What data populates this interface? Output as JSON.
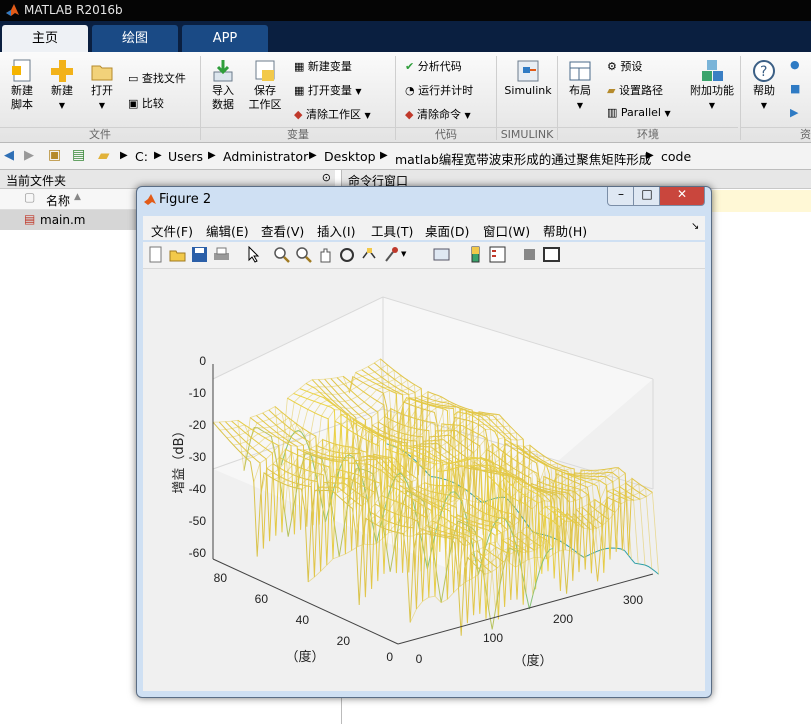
{
  "app": {
    "title": "MATLAB R2016b"
  },
  "tabs": [
    {
      "label": "主页"
    },
    {
      "label": "绘图"
    },
    {
      "label": "APP"
    }
  ],
  "ribbon": {
    "new_script": "新建\n脚本",
    "new": "新建",
    "open": "打开",
    "find_files": "查找文件",
    "compare": "比较",
    "import_data": "导入\n数据",
    "save_workspace": "保存\n工作区",
    "new_variable": "新建变量",
    "open_variable": "打开变量",
    "clear_workspace": "清除工作区",
    "analyze_code": "分析代码",
    "run_and_time": "运行并计时",
    "clear_commands": "清除命令",
    "simulink": "Simulink",
    "layout": "布局",
    "preferences": "预设",
    "set_path": "设置路径",
    "parallel": "Parallel",
    "addons": "附加功能",
    "help": "帮助",
    "sections": {
      "file": "文件",
      "variable": "变量",
      "code": "代码",
      "simulink": "SIMULINK",
      "environment": "环境",
      "resources": "资"
    }
  },
  "address": {
    "crumbs": [
      "C:",
      "Users",
      "Administrator",
      "Desktop",
      "matlab编程宽带波束形成的通过聚焦矩阵形成",
      "code"
    ]
  },
  "current_folder": {
    "title": "当前文件夹",
    "column_name": "名称",
    "files": [
      {
        "name": "main.m"
      }
    ]
  },
  "command_window": {
    "title": "命令行窗口"
  },
  "figure": {
    "title": "Figure 2",
    "menu": [
      "文件(F)",
      "编辑(E)",
      "查看(V)",
      "插入(I)",
      "工具(T)",
      "桌面(D)",
      "窗口(W)",
      "帮助(H)"
    ],
    "plot": {
      "type": "mesh-3d",
      "zlabel": "增益（dB）",
      "xlabel": "（度）",
      "ylabel": "（度）",
      "zticks": [
        "0",
        "-10",
        "-20",
        "-30",
        "-40",
        "-50",
        "-60"
      ],
      "yticks": [
        "80",
        "60",
        "40",
        "20",
        "0"
      ],
      "xticks": [
        "0",
        "100",
        "200",
        "300"
      ],
      "zlim": [
        -60,
        0
      ],
      "ylim": [
        0,
        90
      ],
      "xlim": [
        0,
        360
      ],
      "colormap": [
        "#2e9fa8",
        "#7ec27a",
        "#e0c44a",
        "#f7e240"
      ]
    }
  }
}
